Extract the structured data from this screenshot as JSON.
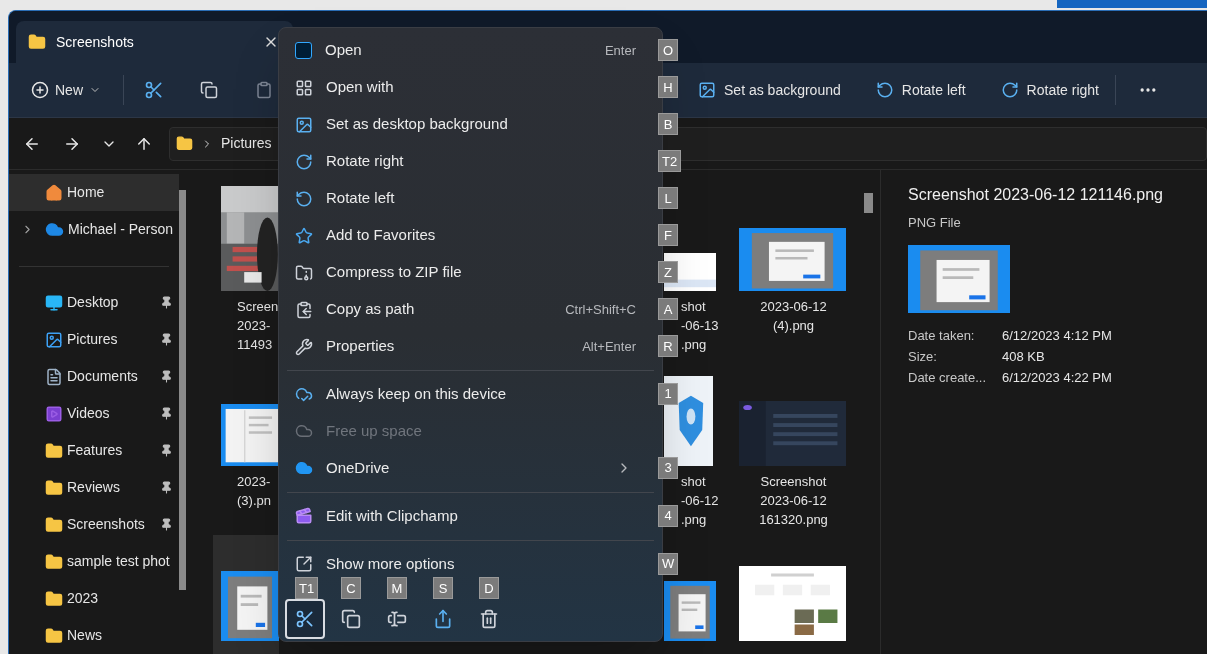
{
  "tab": {
    "title": "Screenshots"
  },
  "toolbar": {
    "new_label": "New",
    "actions": [
      {
        "kind": "set_background",
        "label": "Set as background"
      },
      {
        "kind": "rotate_left",
        "label": "Rotate left"
      },
      {
        "kind": "rotate_right",
        "label": "Rotate right"
      }
    ]
  },
  "address_bar": {
    "path": [
      "Pictures"
    ]
  },
  "sidebar": {
    "items": [
      {
        "kind": "home",
        "label": "Home",
        "selected": true,
        "pinned": false
      },
      {
        "kind": "cloud",
        "label": "Michael - Person",
        "selected": false,
        "pinned": false
      },
      {
        "kind": "divider"
      },
      {
        "kind": "desktop",
        "label": "Desktop",
        "selected": false,
        "pinned": true
      },
      {
        "kind": "pictures",
        "label": "Pictures",
        "selected": false,
        "pinned": true
      },
      {
        "kind": "documents",
        "label": "Documents",
        "selected": false,
        "pinned": true
      },
      {
        "kind": "videos",
        "label": "Videos",
        "selected": false,
        "pinned": true
      },
      {
        "kind": "folder",
        "label": "Features",
        "selected": false,
        "pinned": true
      },
      {
        "kind": "folder",
        "label": "Reviews",
        "selected": false,
        "pinned": true
      },
      {
        "kind": "folder",
        "label": "Screenshots",
        "selected": false,
        "pinned": true
      },
      {
        "kind": "folder",
        "label": "sample test phot",
        "selected": false,
        "pinned": false
      },
      {
        "kind": "folder",
        "label": "2023",
        "selected": false,
        "pinned": false
      },
      {
        "kind": "folder",
        "label": "News",
        "selected": false,
        "pinned": false
      }
    ]
  },
  "files": {
    "rows": [
      [
        {
          "kind": "picture",
          "selected": false,
          "name_lines": [
            "Screen",
            "2023-",
            "11493"
          ]
        },
        {
          "kind": "picture",
          "selected": false,
          "name_lines": [
            "shot",
            "-06-13",
            ".png"
          ]
        },
        {
          "kind": "picture",
          "selected": false,
          "name_lines": [
            "2023-06-12",
            "(4).png"
          ]
        }
      ],
      [
        {
          "kind": "picture",
          "selected": false,
          "name_lines": [
            "2023-",
            "(3).pn"
          ]
        },
        {
          "kind": "picture",
          "selected": false,
          "name_lines": [
            "shot",
            "-06-12",
            ".png"
          ]
        },
        {
          "kind": "picture",
          "selected": false,
          "name_lines": [
            "Screenshot",
            "2023-06-12",
            "161320.png"
          ]
        }
      ],
      [
        {
          "kind": "picture",
          "selected": true
        },
        {
          "kind": "picture",
          "selected": false
        },
        {
          "kind": "picture",
          "selected": false
        }
      ]
    ]
  },
  "details": {
    "title": "Screenshot 2023-06-12 121146.png",
    "type": "PNG File",
    "properties": [
      {
        "label": "Date taken:",
        "value": "6/12/2023 4:12 PM"
      },
      {
        "label": "Size:",
        "value": "408 KB"
      },
      {
        "label": "Date create...",
        "value": "6/12/2023 4:22 PM"
      }
    ]
  },
  "context_menu": {
    "items": [
      {
        "kind": "open",
        "label": "Open",
        "shortcut": "Enter",
        "access_key": "O",
        "disabled": false
      },
      {
        "kind": "open_with",
        "label": "Open with",
        "access_key": "H",
        "disabled": false
      },
      {
        "kind": "set_background",
        "label": "Set as desktop background",
        "access_key": "B",
        "disabled": false
      },
      {
        "kind": "rotate_right",
        "label": "Rotate right",
        "access_key": "T2",
        "disabled": false
      },
      {
        "kind": "rotate_left",
        "label": "Rotate left",
        "access_key": "L",
        "disabled": false
      },
      {
        "kind": "favorite",
        "label": "Add to Favorites",
        "access_key": "F",
        "disabled": false
      },
      {
        "kind": "zip",
        "label": "Compress to ZIP file",
        "access_key": "Z",
        "disabled": false
      },
      {
        "kind": "copy_path",
        "label": "Copy as path",
        "shortcut": "Ctrl+Shift+C",
        "access_key": "A",
        "disabled": false
      },
      {
        "kind": "properties",
        "label": "Properties",
        "shortcut": "Alt+Enter",
        "access_key": "R",
        "disabled": false
      },
      {
        "kind": "separator"
      },
      {
        "kind": "keep",
        "label": "Always keep on this device",
        "access_key": "1",
        "disabled": false
      },
      {
        "kind": "free",
        "label": "Free up space",
        "disabled": true
      },
      {
        "kind": "onedrive",
        "label": "OneDrive",
        "access_key": "3",
        "disabled": false
      },
      {
        "kind": "separator"
      },
      {
        "kind": "clipchamp",
        "label": "Edit with Clipchamp",
        "access_key": "4",
        "disabled": false
      },
      {
        "kind": "separator"
      },
      {
        "kind": "more",
        "label": "Show more options",
        "access_key": "W",
        "disabled": false
      }
    ],
    "actions": [
      {
        "kind": "cut",
        "access_key": "T1",
        "selected": true
      },
      {
        "kind": "copy",
        "access_key": "C",
        "selected": false
      },
      {
        "kind": "rename",
        "access_key": "M",
        "selected": false
      },
      {
        "kind": "share",
        "access_key": "S",
        "selected": false
      },
      {
        "kind": "delete",
        "access_key": "D",
        "selected": false
      }
    ]
  }
}
